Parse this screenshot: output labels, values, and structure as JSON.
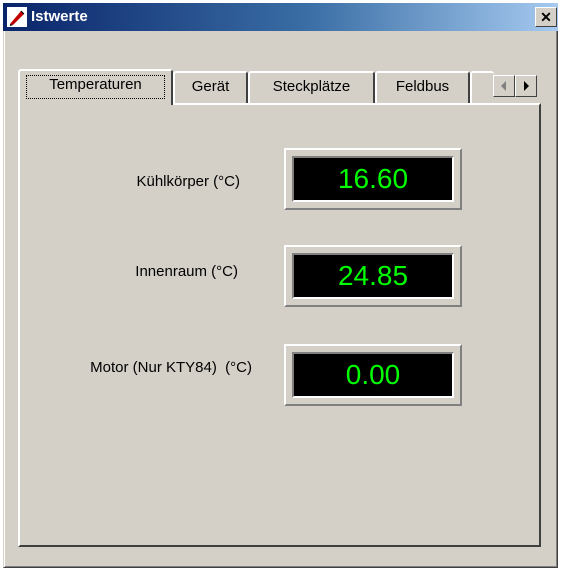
{
  "window": {
    "title": "Istwerte",
    "close_symbol": "✕",
    "icon": "pen-icon"
  },
  "tabs": [
    {
      "label": "Temperaturen",
      "active": true
    },
    {
      "label": "Gerät",
      "active": false
    },
    {
      "label": "Steckplätze",
      "active": false
    },
    {
      "label": "Feldbus",
      "active": false
    }
  ],
  "readings": [
    {
      "label": "Kühlkörper (°C)",
      "value": "16.60"
    },
    {
      "label": "Innenraum (°C)",
      "value": "24.85"
    },
    {
      "label": "Motor (Nur KTY84)  (°C)",
      "value": "0.00"
    }
  ],
  "colors": {
    "display_text": "#00ff00",
    "display_bg": "#000000",
    "face": "#d4d0c8",
    "titlebar_start": "#0a246a",
    "titlebar_end": "#a6caf0"
  }
}
